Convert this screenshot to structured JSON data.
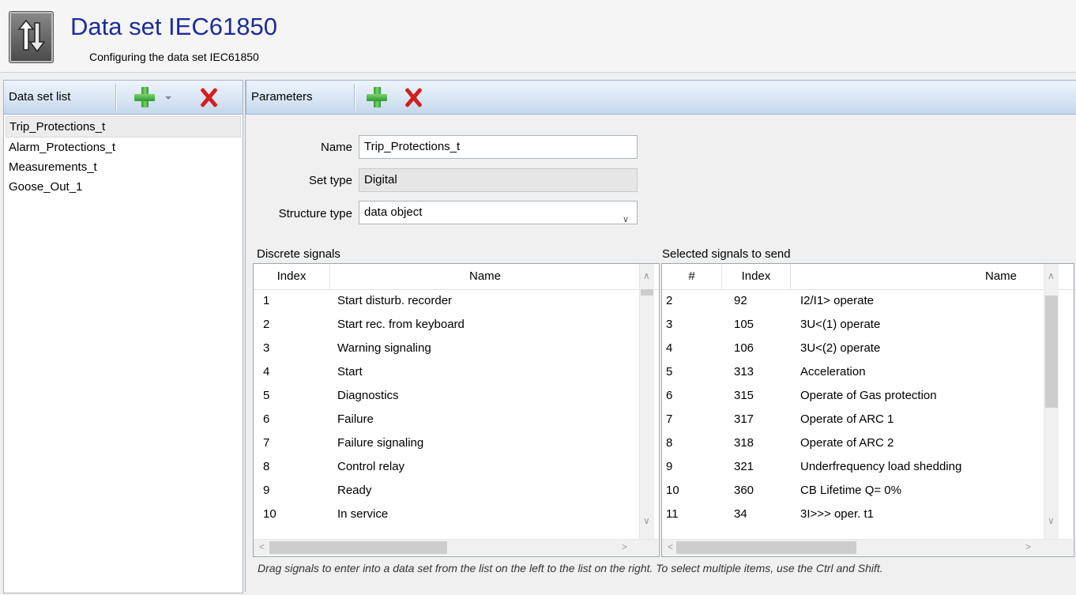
{
  "header": {
    "title": "Data set IEC61850",
    "subtitle": "Configuring the data set IEC61850",
    "icon": "up-down-arrows-icon"
  },
  "dataset_panel": {
    "label": "Data set list",
    "items": [
      "Trip_Protections_t",
      "Alarm_Protections_t",
      "Measurements_t",
      "Goose_Out_1"
    ],
    "selected_index": 0
  },
  "parameters_panel": {
    "label": "Parameters",
    "name_label": "Name",
    "name_value": "Trip_Protections_t",
    "set_type_label": "Set type",
    "set_type_value": "Digital",
    "structure_type_label": "Structure type",
    "structure_type_value": "data object"
  },
  "discrete_signals": {
    "label": "Discrete signals",
    "columns": [
      "Index",
      "Name"
    ],
    "rows": [
      [
        "1",
        "Start disturb. recorder"
      ],
      [
        "2",
        "Start rec. from keyboard"
      ],
      [
        "3",
        "Warning signaling"
      ],
      [
        "4",
        "Start"
      ],
      [
        "5",
        "Diagnostics"
      ],
      [
        "6",
        "Failure"
      ],
      [
        "7",
        "Failure signaling"
      ],
      [
        "8",
        "Control relay"
      ],
      [
        "9",
        "Ready"
      ],
      [
        "10",
        "In service"
      ]
    ]
  },
  "selected_signals": {
    "label": "Selected signals to send",
    "columns": [
      "#",
      "Index",
      "Name"
    ],
    "rows": [
      [
        "2",
        "92",
        "I2/I1> operate"
      ],
      [
        "3",
        "105",
        "3U<(1) operate"
      ],
      [
        "4",
        "106",
        "3U<(2) operate"
      ],
      [
        "5",
        "313",
        "Acceleration"
      ],
      [
        "6",
        "315",
        "Operate of Gas protection"
      ],
      [
        "7",
        "317",
        "Operate of ARC 1"
      ],
      [
        "8",
        "318",
        "Operate of ARC 2"
      ],
      [
        "9",
        "321",
        "Underfrequency load shedding"
      ],
      [
        "10",
        "360",
        "CB Lifetime Q= 0%"
      ],
      [
        "11",
        "34",
        "3I>>> oper. t1"
      ]
    ]
  },
  "hint": "Drag signals to enter into a data set from the list on the left to the list on the right. To select multiple items, use the Ctrl and Shift.",
  "colors": {
    "title": "#1b2d99",
    "add": "#2e9a2e",
    "delete": "#d21f1f",
    "toolbar": "#d6e4f3"
  }
}
